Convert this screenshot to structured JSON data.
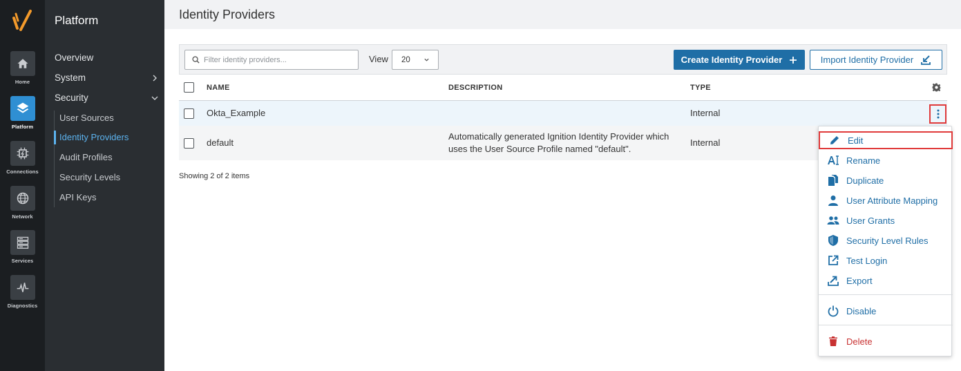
{
  "rail": {
    "items": [
      {
        "label": "Home",
        "icon": "home-icon"
      },
      {
        "label": "Platform",
        "icon": "layers-icon",
        "active": true
      },
      {
        "label": "Connections",
        "icon": "connections-icon"
      },
      {
        "label": "Network",
        "icon": "globe-icon"
      },
      {
        "label": "Services",
        "icon": "server-icon"
      },
      {
        "label": "Diagnostics",
        "icon": "pulse-icon"
      }
    ]
  },
  "subnav": {
    "title": "Platform",
    "items": {
      "overview": "Overview",
      "system": "System",
      "security": "Security"
    },
    "security_children": [
      "User Sources",
      "Identity Providers",
      "Audit Profiles",
      "Security Levels",
      "API Keys"
    ]
  },
  "page": {
    "title": "Identity Providers"
  },
  "toolbar": {
    "search_placeholder": "Filter identity providers...",
    "view_label": "View",
    "view_value": "20",
    "create_label": "Create Identity Provider",
    "import_label": "Import Identity Provider"
  },
  "table": {
    "columns": [
      "NAME",
      "DESCRIPTION",
      "TYPE"
    ],
    "rows": [
      {
        "name": "Okta_Example",
        "description_line1": "",
        "description_line2": "",
        "type": "Internal"
      },
      {
        "name": "default",
        "description_line1": "Automatically generated Ignition Identity Provider which",
        "description_line2": "uses the User Source Profile named \"default\".",
        "type": "Internal"
      }
    ],
    "footer": "Showing 2 of 2 items"
  },
  "menu": {
    "items": [
      {
        "label": "Edit",
        "icon": "pencil-icon"
      },
      {
        "label": "Rename",
        "icon": "rename-icon"
      },
      {
        "label": "Duplicate",
        "icon": "duplicate-icon"
      },
      {
        "label": "User Attribute Mapping",
        "icon": "user-icon"
      },
      {
        "label": "User Grants",
        "icon": "users-icon"
      },
      {
        "label": "Security Level Rules",
        "icon": "shield-icon"
      },
      {
        "label": "Test Login",
        "icon": "external-link-icon"
      },
      {
        "label": "Export",
        "icon": "export-icon"
      },
      {
        "label": "Disable",
        "icon": "power-icon"
      },
      {
        "label": "Delete",
        "icon": "trash-icon"
      }
    ]
  },
  "colors": {
    "accent": "#1f6ea6",
    "active_nav": "#5cb3ef",
    "highlight": "#e03a3a",
    "danger": "#c83232",
    "logo": "#f39a2b"
  }
}
